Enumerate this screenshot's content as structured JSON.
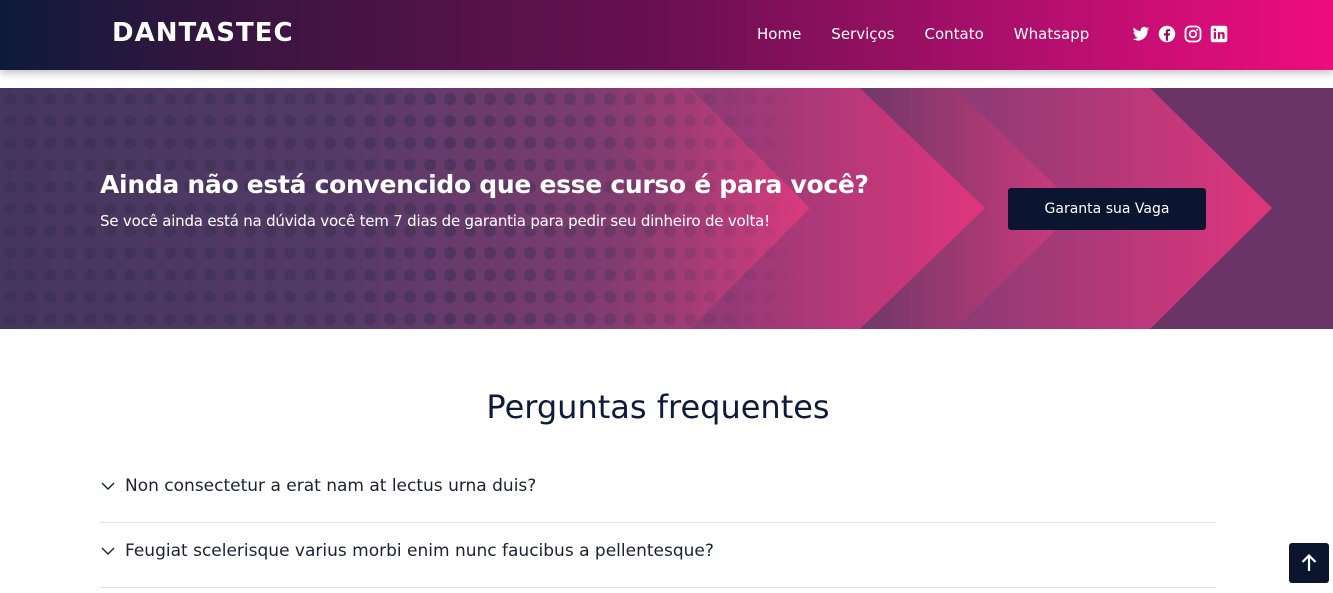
{
  "header": {
    "brand": "DANTASTEC",
    "nav": [
      "Home",
      "Serviços",
      "Contato",
      "Whatsapp"
    ],
    "social_icons": [
      "twitter-icon",
      "facebook-icon",
      "instagram-icon",
      "linkedin-icon"
    ]
  },
  "banner": {
    "title": "Ainda não está convencido que esse curso é para você?",
    "subtitle": "Se você ainda está na dúvida você tem 7 dias de garantia para pedir seu dinheiro de volta!",
    "cta_label": "Garanta sua Vaga"
  },
  "faq": {
    "title": "Perguntas frequentes",
    "items": [
      {
        "question": "Non consectetur a erat nam at lectus urna duis?"
      },
      {
        "question": "Feugiat scelerisque varius morbi enim nunc faucibus a pellentesque?"
      }
    ]
  },
  "back_to_top_icon": "arrow-up-icon",
  "colors": {
    "dark_navy": "#0b1530",
    "magenta": "#ef0c7e",
    "purple": "#6a1050"
  }
}
